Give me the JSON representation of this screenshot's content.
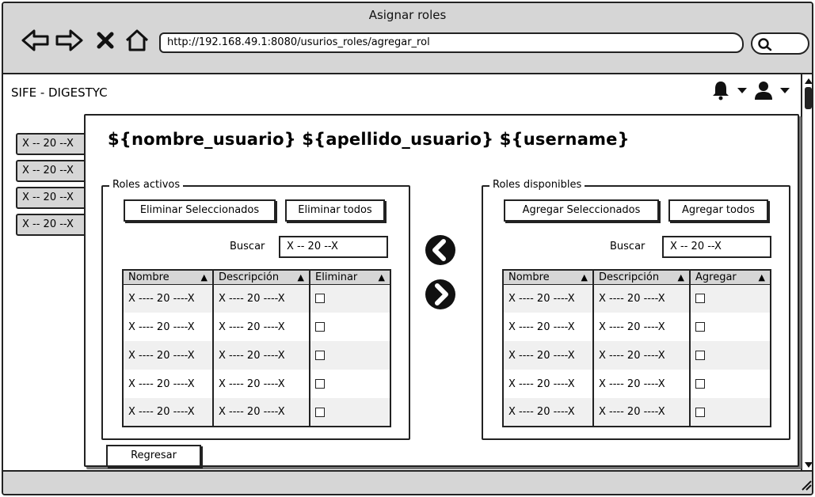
{
  "window": {
    "title": "Asignar roles",
    "url": "http://192.168.49.1:8080/usurios_roles/agregar_rol"
  },
  "icons": {
    "back": "arrow-left-outline-icon",
    "forward": "arrow-right-outline-icon",
    "stop": "x-icon",
    "home": "home-outline-icon",
    "search": "magnifier-icon",
    "notifications": "bell-icon",
    "user": "user-icon",
    "move_left": "circle-arrow-left-icon",
    "move_right": "circle-arrow-right-icon"
  },
  "app": {
    "name": "SIFE - DIGESTYC"
  },
  "sidebar": {
    "items": [
      {
        "label": "X -- 20 --X"
      },
      {
        "label": "X -- 20 --X"
      },
      {
        "label": "X -- 20 --X"
      },
      {
        "label": "X -- 20 --X"
      }
    ]
  },
  "dialog": {
    "title": "${nombre_usuario} ${apellido_usuario} ${username}",
    "back_button": "Regresar"
  },
  "active_roles": {
    "legend": "Roles activos",
    "remove_selected": "Eliminar Seleccionados",
    "remove_all": "Eliminar todos",
    "search_label": "Buscar",
    "search_value": "X -- 20 --X",
    "columns": [
      "Nombre",
      "Descripción",
      "Eliminar"
    ],
    "rows": [
      {
        "nombre": "X ---- 20 ----X",
        "descripcion": "X ---- 20 ----X",
        "checked": false
      },
      {
        "nombre": "X ---- 20 ----X",
        "descripcion": "X ---- 20 ----X",
        "checked": false
      },
      {
        "nombre": "X ---- 20 ----X",
        "descripcion": "X ---- 20 ----X",
        "checked": false
      },
      {
        "nombre": "X ---- 20 ----X",
        "descripcion": "X ---- 20 ----X",
        "checked": false
      },
      {
        "nombre": "X ---- 20 ----X",
        "descripcion": "X ---- 20 ----X",
        "checked": false
      }
    ]
  },
  "available_roles": {
    "legend": "Roles disponibles",
    "add_selected": "Agregar Seleccionados",
    "add_all": "Agregar todos",
    "search_label": "Buscar",
    "search_value": "X -- 20 --X",
    "columns": [
      "Nombre",
      "Descripción",
      "Agregar"
    ],
    "rows": [
      {
        "nombre": "X ---- 20 ----X",
        "descripcion": "X ---- 20 ----X",
        "checked": false
      },
      {
        "nombre": "X ---- 20 ----X",
        "descripcion": "X ---- 20 ----X",
        "checked": false
      },
      {
        "nombre": "X ---- 20 ----X",
        "descripcion": "X ---- 20 ----X",
        "checked": false
      },
      {
        "nombre": "X ---- 20 ----X",
        "descripcion": "X ---- 20 ----X",
        "checked": false
      },
      {
        "nombre": "X ---- 20 ----X",
        "descripcion": "X ---- 20 ----X",
        "checked": false
      }
    ]
  }
}
